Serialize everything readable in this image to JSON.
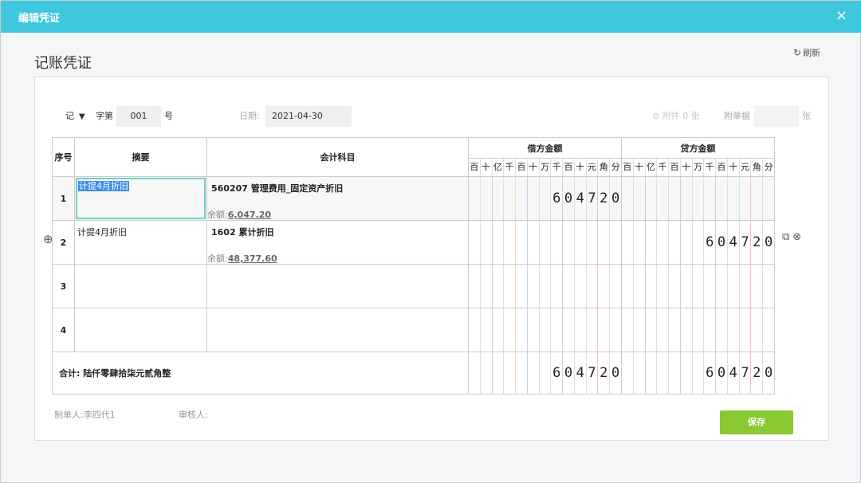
{
  "dialog": {
    "title": "编辑凭证",
    "close": "×"
  },
  "page": {
    "title": "记账凭证",
    "refresh_label": "刷新",
    "refresh_icon": "↻"
  },
  "header": {
    "voucher_type": "记",
    "zi_label": "字第",
    "voucher_number": "001",
    "hao_label": "号",
    "date_label": "日期:",
    "date_value": "2021-04-30",
    "attachment_label": "附件 0 张",
    "attach_doc_label": "附单据",
    "attach_doc_value": "",
    "zhang_label": "张"
  },
  "table": {
    "col_seq": "序号",
    "col_summary": "摘要",
    "col_subject": "会计科目",
    "col_debit": "借方金额",
    "col_credit": "贷方金额",
    "digit_units": [
      "百",
      "十",
      "亿",
      "千",
      "百",
      "十",
      "万",
      "千",
      "百",
      "十",
      "元",
      "角",
      "分"
    ],
    "rows": [
      {
        "seq": "1",
        "summary": "计提4月折旧",
        "subject": "560207 管理费用_固定资产折旧",
        "balance_label": "余额:",
        "balance": "6,047.20",
        "debit": [
          "",
          "",
          "",
          "",
          "",
          "",
          "",
          "6",
          "0",
          "4",
          "7",
          "2",
          "0"
        ],
        "credit": [
          "",
          "",
          "",
          "",
          "",
          "",
          "",
          "",
          "",
          "",
          "",
          "",
          ""
        ]
      },
      {
        "seq": "2",
        "summary": "计提4月折旧",
        "subject": "1602 累计折旧",
        "balance_label": "余额:",
        "balance": "48,377.60",
        "debit": [
          "",
          "",
          "",
          "",
          "",
          "",
          "",
          "",
          "",
          "",
          "",
          "",
          ""
        ],
        "credit": [
          "",
          "",
          "",
          "",
          "",
          "",
          "",
          "6",
          "0",
          "4",
          "7",
          "2",
          "0"
        ]
      },
      {
        "seq": "3",
        "summary": "",
        "subject": "",
        "balance_label": "",
        "balance": "",
        "debit": [
          "",
          "",
          "",
          "",
          "",
          "",
          "",
          "",
          "",
          "",
          "",
          "",
          ""
        ],
        "credit": [
          "",
          "",
          "",
          "",
          "",
          "",
          "",
          "",
          "",
          "",
          "",
          "",
          ""
        ]
      },
      {
        "seq": "4",
        "summary": "",
        "subject": "",
        "balance_label": "",
        "balance": "",
        "debit": [
          "",
          "",
          "",
          "",
          "",
          "",
          "",
          "",
          "",
          "",
          "",
          "",
          ""
        ],
        "credit": [
          "",
          "",
          "",
          "",
          "",
          "",
          "",
          "",
          "",
          "",
          "",
          "",
          ""
        ]
      }
    ],
    "total_label": "合计:",
    "total_text": "陆仟零肆拾柒元贰角整",
    "total_debit": [
      "",
      "",
      "",
      "",
      "",
      "",
      "",
      "6",
      "0",
      "4",
      "7",
      "2",
      "0"
    ],
    "total_credit": [
      "",
      "",
      "",
      "",
      "",
      "",
      "",
      "6",
      "0",
      "4",
      "7",
      "2",
      "0"
    ]
  },
  "footer": {
    "maker_label": "制单人:",
    "maker": "李四代1",
    "reviewer_label": "审核人:",
    "reviewer": "",
    "save_label": "保存"
  }
}
